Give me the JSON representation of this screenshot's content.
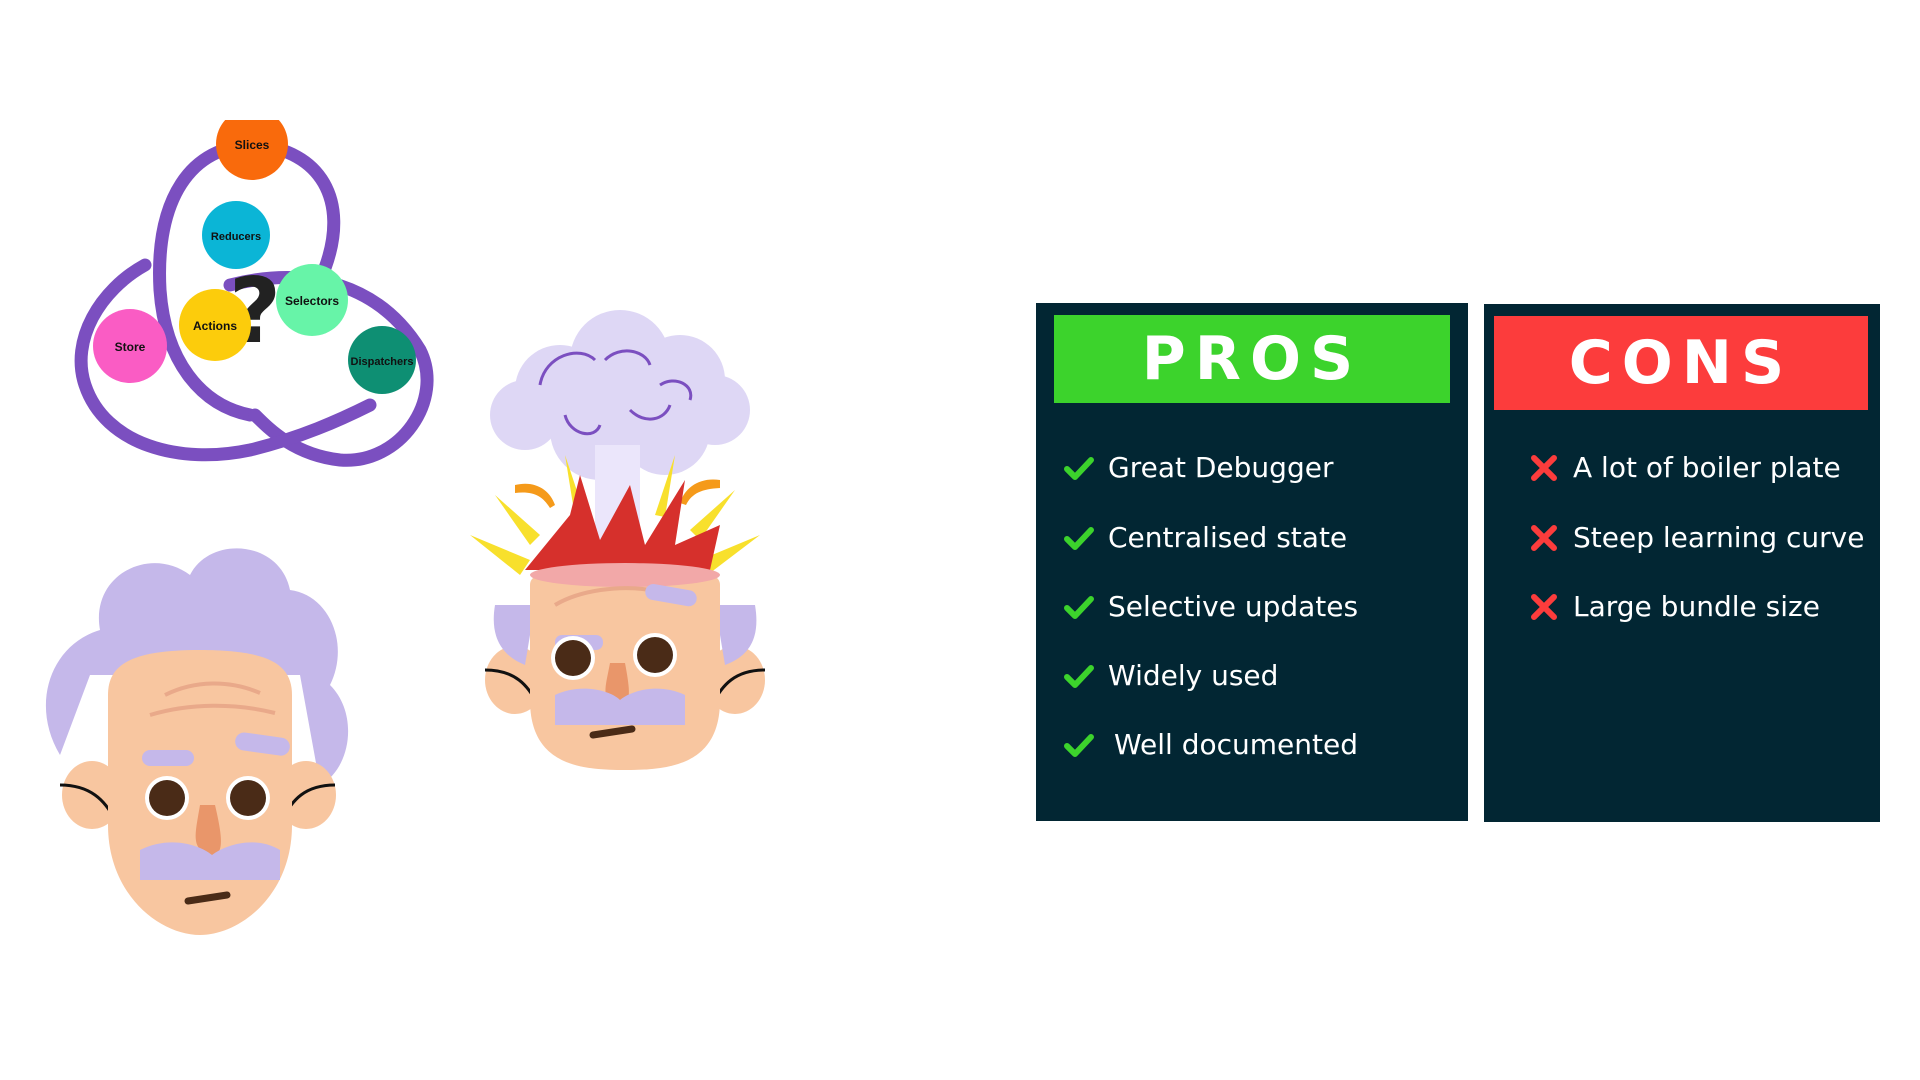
{
  "diagram": {
    "question_mark": "?",
    "nodes": [
      {
        "id": "slices",
        "label": "Slices",
        "color": "#f96a0c"
      },
      {
        "id": "reducers",
        "label": "Reducers",
        "color": "#0bb5d6"
      },
      {
        "id": "selectors",
        "label": "Selectors",
        "color": "#67f4a8"
      },
      {
        "id": "actions",
        "label": "Actions",
        "color": "#fccc0c"
      },
      {
        "id": "store",
        "label": "Store",
        "color": "#fa5cc4"
      },
      {
        "id": "dispatchers",
        "label": "Dispatchers",
        "color": "#0e8f73"
      }
    ],
    "ring_color": "#7b4fc0"
  },
  "pros": {
    "title": "PROS",
    "banner_color": "#3cd32c",
    "icon": "check-icon",
    "items": [
      "Great Debugger",
      "Centralised state",
      "Selective updates",
      "Widely used",
      "Well documented"
    ]
  },
  "cons": {
    "title": "CONS",
    "banner_color": "#fc3c3c",
    "icon": "cross-icon",
    "items": [
      "A lot of boiler plate",
      "Steep learning curve",
      "Large bundle size"
    ]
  },
  "colors": {
    "panel_bg": "#022633",
    "check": "#3cd32c",
    "cross": "#fc3c3c"
  }
}
